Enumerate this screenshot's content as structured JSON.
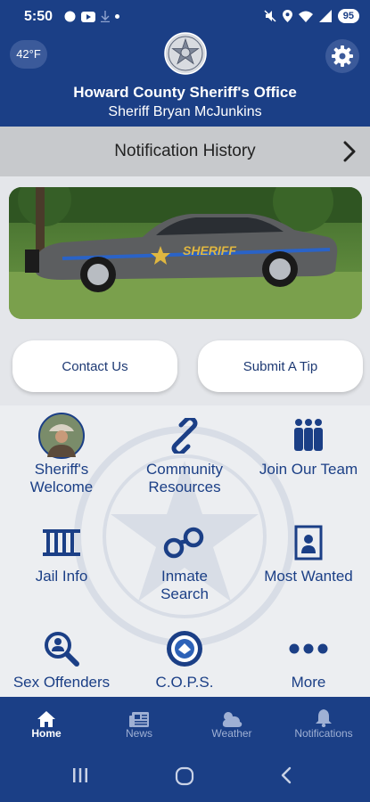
{
  "status": {
    "time": "5:50",
    "battery": "95"
  },
  "header": {
    "temperature": "42°F",
    "agency_name": "Howard County Sheriff's Office",
    "sheriff_name": "Sheriff Bryan McJunkins"
  },
  "notification_bar": {
    "label": "Notification History"
  },
  "buttons": {
    "contact": "Contact Us",
    "tip": "Submit A Tip"
  },
  "tiles": [
    {
      "label_1": "Sheriff's",
      "label_2": "Welcome",
      "icon": "sheriff-portrait"
    },
    {
      "label_1": "Community",
      "label_2": "Resources",
      "icon": "link-icon"
    },
    {
      "label_1": "Join Our Team",
      "label_2": "",
      "icon": "group-icon"
    },
    {
      "label_1": "Jail Info",
      "label_2": "",
      "icon": "jail-bars-icon"
    },
    {
      "label_1": "Inmate",
      "label_2": "Search",
      "icon": "handcuffs-icon"
    },
    {
      "label_1": "Most Wanted",
      "label_2": "",
      "icon": "wanted-poster-icon"
    },
    {
      "label_1": "Sex Offenders",
      "label_2": "",
      "icon": "magnify-person-icon"
    },
    {
      "label_1": "C.O.P.S.",
      "label_2": "",
      "icon": "cops-seal-icon"
    },
    {
      "label_1": "More",
      "label_2": "",
      "icon": "more-dots-icon"
    }
  ],
  "bottom_nav": [
    {
      "label": "Home",
      "icon": "home-icon",
      "active": true
    },
    {
      "label": "News",
      "icon": "newspaper-icon",
      "active": false
    },
    {
      "label": "Weather",
      "icon": "weather-icon",
      "active": false
    },
    {
      "label": "Notifications",
      "icon": "bell-icon",
      "active": false
    }
  ],
  "colors": {
    "brand_blue": "#1b3f86",
    "header_chip": "#3b5a9a",
    "notification_bar": "#c7c9cc",
    "page_background": "#e4e6ea"
  }
}
